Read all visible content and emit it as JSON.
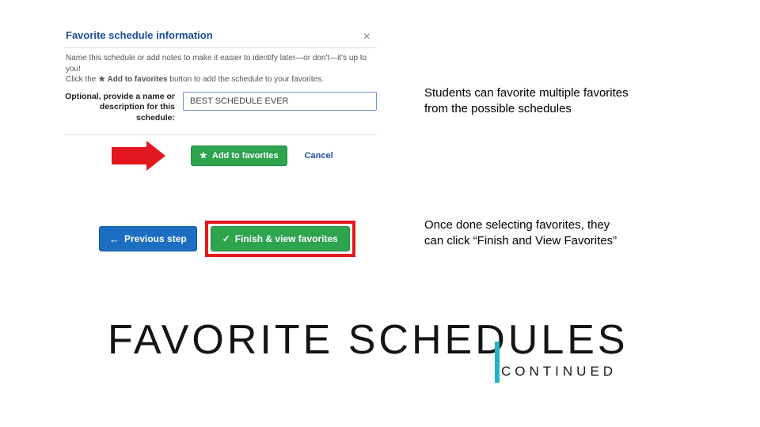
{
  "modal": {
    "title": "Favorite schedule information",
    "instructions_line1": "Name this schedule or add notes to make it easier to identify later—or don't—it's up to you!",
    "instructions_line2_prefix": "Click the ",
    "instructions_line2_bold": "★ Add to favorites",
    "instructions_line2_suffix": " button to add the schedule to your favorites.",
    "label": "Optional, provide a name or description for this schedule:",
    "input_value": "BEST SCHEDULE EVER",
    "add_label": "Add to favorites",
    "cancel_label": "Cancel"
  },
  "nav": {
    "prev_label": "Previous step",
    "finish_label": "Finish & view favorites"
  },
  "captions": {
    "c1": "Students can favorite multiple favorites from the possible schedules",
    "c2": "Once done selecting favorites, they can click “Finish and View Favorites”"
  },
  "slide": {
    "title": "FAVORITE SCHEDULES",
    "subtitle": "CONTINUED"
  }
}
